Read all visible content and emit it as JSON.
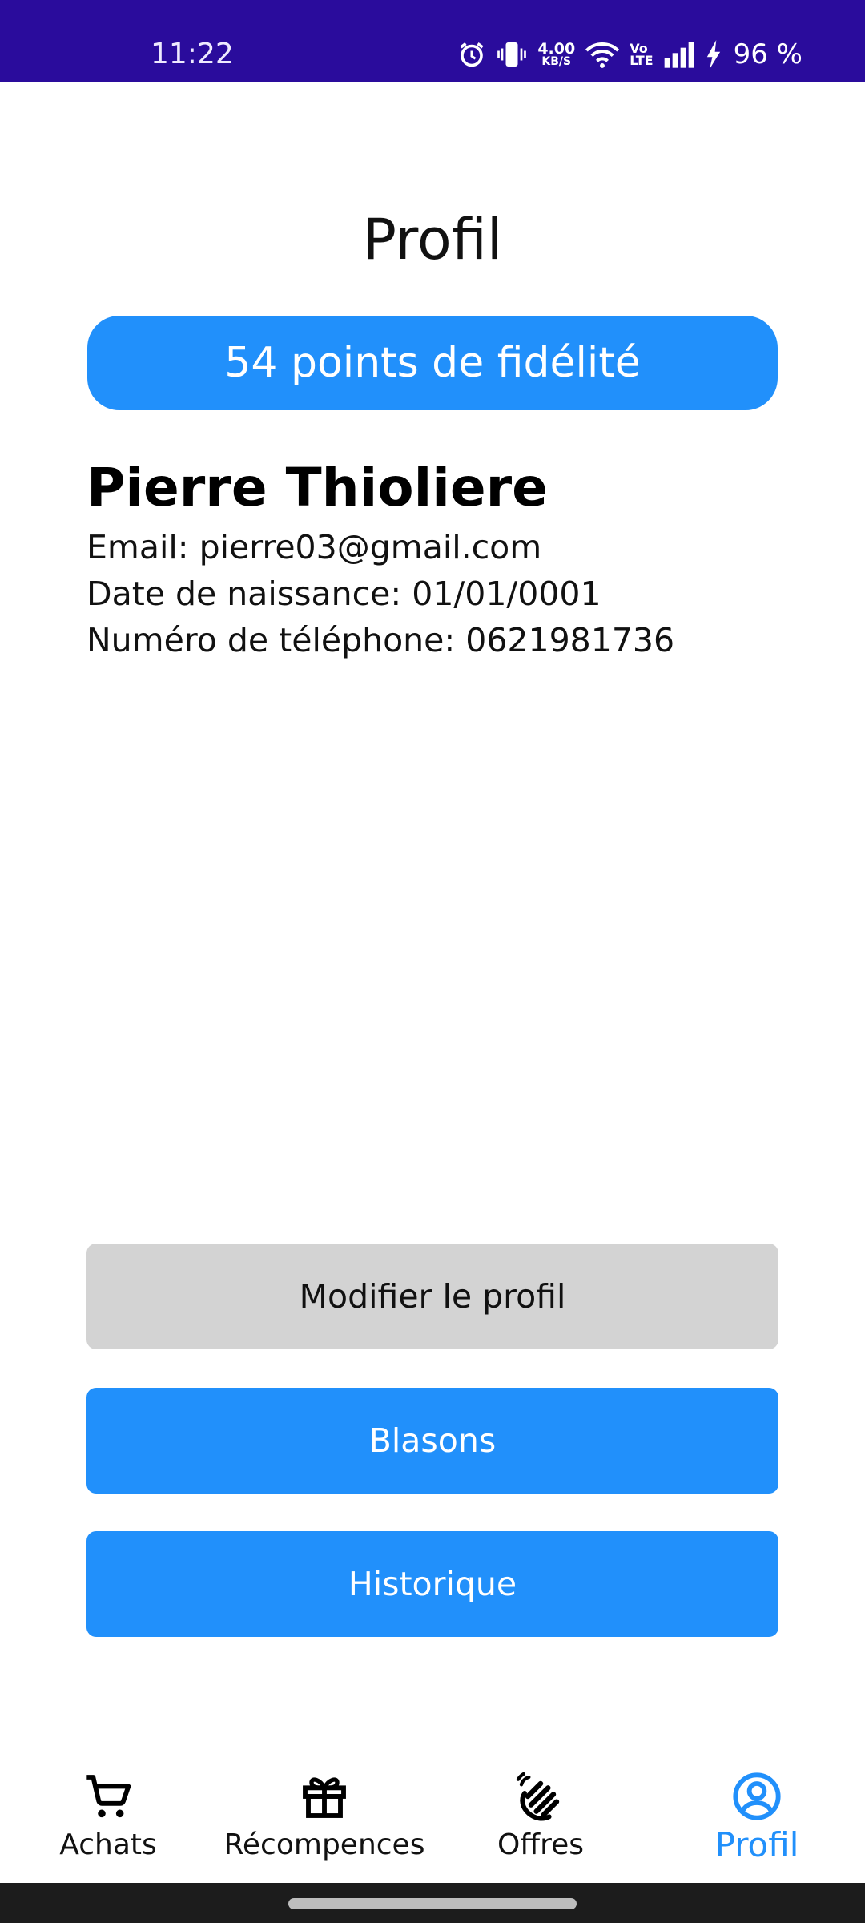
{
  "status_bar": {
    "time": "11:22",
    "net_speed": "4.00",
    "net_unit": "KB/S",
    "volte_top": "Vo",
    "volte_bottom": "LTE",
    "battery": "96 %"
  },
  "profile": {
    "title": "Profil",
    "points_label": "54 points de fidélité",
    "name": "Pierre Thioliere",
    "email_line": "Email: pierre03@gmail.com",
    "birth_line": "Date de naissance: 01/01/0001",
    "phone_line": "Numéro de téléphone: 0621981736"
  },
  "actions": {
    "edit_label": "Modifier le profil",
    "badges_label": "Blasons",
    "history_label": "Historique"
  },
  "nav": {
    "items": [
      {
        "label": "Achats",
        "icon": "cart-icon"
      },
      {
        "label": "Récompences",
        "icon": "gift-icon"
      },
      {
        "label": "Offres",
        "icon": "hand-wave-icon"
      },
      {
        "label": "Profil",
        "icon": "account-circle-icon",
        "active": true
      }
    ]
  },
  "colors": {
    "accent": "#2190fb",
    "status_bar": "#2a0c9c",
    "secondary_button": "#d3d3d3"
  }
}
